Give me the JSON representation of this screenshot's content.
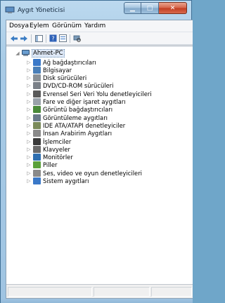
{
  "window": {
    "title": "Aygıt Yöneticisi",
    "icon": "device-manager-icon",
    "buttons": {
      "minimize": "▁",
      "maximize": "□",
      "close": "✕"
    }
  },
  "menu": {
    "items": [
      "Dosya",
      "Eylem",
      "Görünüm",
      "Yardım"
    ]
  },
  "toolbar": {
    "buttons": [
      "back-arrow-icon",
      "forward-arrow-icon",
      "show-hide-tree-icon",
      "help-icon",
      "properties-icon",
      "scan-hardware-icon"
    ]
  },
  "tree": {
    "root": {
      "label": "Ahmet-PC",
      "icon": "computer-icon",
      "expanded": true
    },
    "items": [
      {
        "label": "Ağ bağdaştırıcıları",
        "icon": "network-adapter-icon",
        "color": "#3a78c8"
      },
      {
        "label": "Bilgisayar",
        "icon": "computer-icon",
        "color": "#4a7fb8"
      },
      {
        "label": "Disk sürücüleri",
        "icon": "disk-drive-icon",
        "color": "#8a9096"
      },
      {
        "label": "DVD/CD-ROM sürücüleri",
        "icon": "dvd-drive-icon",
        "color": "#7a8088"
      },
      {
        "label": "Evrensel Seri Veri Yolu denetleyicileri",
        "icon": "usb-icon",
        "color": "#5a5a5a"
      },
      {
        "label": "Fare ve diğer işaret aygıtları",
        "icon": "mouse-icon",
        "color": "#9aa2aa"
      },
      {
        "label": "Görüntü bağdaştırıcıları",
        "icon": "display-adapter-icon",
        "color": "#4a8a3a"
      },
      {
        "label": "Görüntüleme aygıtları",
        "icon": "imaging-device-icon",
        "color": "#6a7a8a"
      },
      {
        "label": "IDE ATA/ATAPI denetleyiciler",
        "icon": "ide-controller-icon",
        "color": "#7a8a5a"
      },
      {
        "label": "İnsan Arabirim Aygıtları",
        "icon": "hid-icon",
        "color": "#8a8a8a"
      },
      {
        "label": "İşlemciler",
        "icon": "processor-icon",
        "color": "#3a3a3a"
      },
      {
        "label": "Klavyeler",
        "icon": "keyboard-icon",
        "color": "#6a6a6a"
      },
      {
        "label": "Monitörler",
        "icon": "monitor-icon",
        "color": "#2f6fb0"
      },
      {
        "label": "Piller",
        "icon": "battery-icon",
        "color": "#5aa03a"
      },
      {
        "label": "Ses, video ve oyun denetleyicileri",
        "icon": "sound-icon",
        "color": "#8a8a8a"
      },
      {
        "label": "Sistem aygıtları",
        "icon": "system-device-icon",
        "color": "#3a78c8"
      }
    ]
  },
  "colors": {
    "titlebar": "#a8cbe6",
    "close_button": "#c13d22",
    "selection": "#dfe9f7"
  }
}
